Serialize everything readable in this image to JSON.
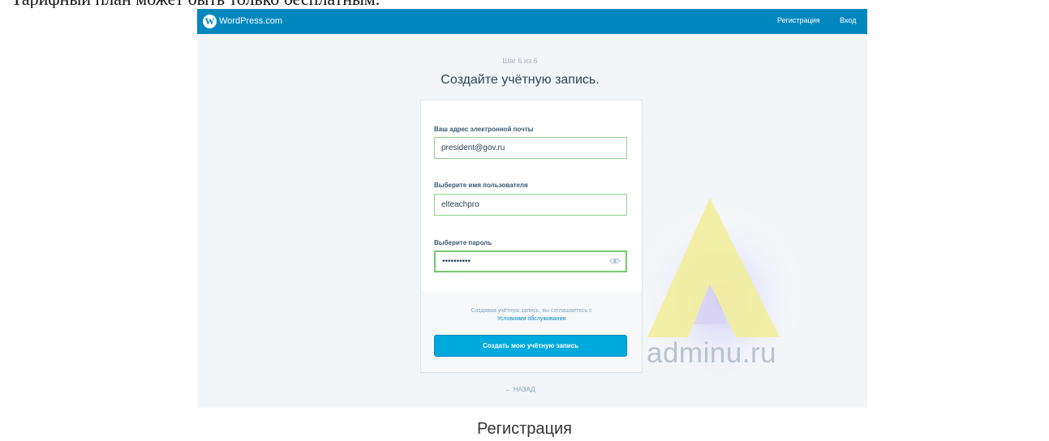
{
  "article": {
    "caption_top": "Тарифный план может быть только бесплатным.",
    "caption_bottom": "Регистрация"
  },
  "header": {
    "brand": "WordPress.com",
    "nav": {
      "signup": "Регистрация",
      "login": "Вход"
    }
  },
  "form": {
    "step": "Шаг 6 из 6",
    "title": "Создайте учётную запись.",
    "email": {
      "label": "Ваш адрес электронной почты",
      "value": "president@gov.ru"
    },
    "username": {
      "label": "Выберите имя пользователя",
      "value": "elteachpro"
    },
    "password": {
      "label": "Выберите пароль",
      "value": "••••••••••"
    },
    "terms_text": "Создавая учётную запись, вы соглашаетесь с",
    "terms_link": "Условиями обслуживания",
    "submit_label": "Создать мою учётную запись",
    "back_label": "← НАЗАД"
  },
  "watermark": {
    "text": "adminu.ru"
  },
  "colors": {
    "header_bg": "#0087be",
    "button_bg": "#00aadc",
    "input_border": "#8fd18c",
    "page_bg": "#f3f6f8"
  }
}
